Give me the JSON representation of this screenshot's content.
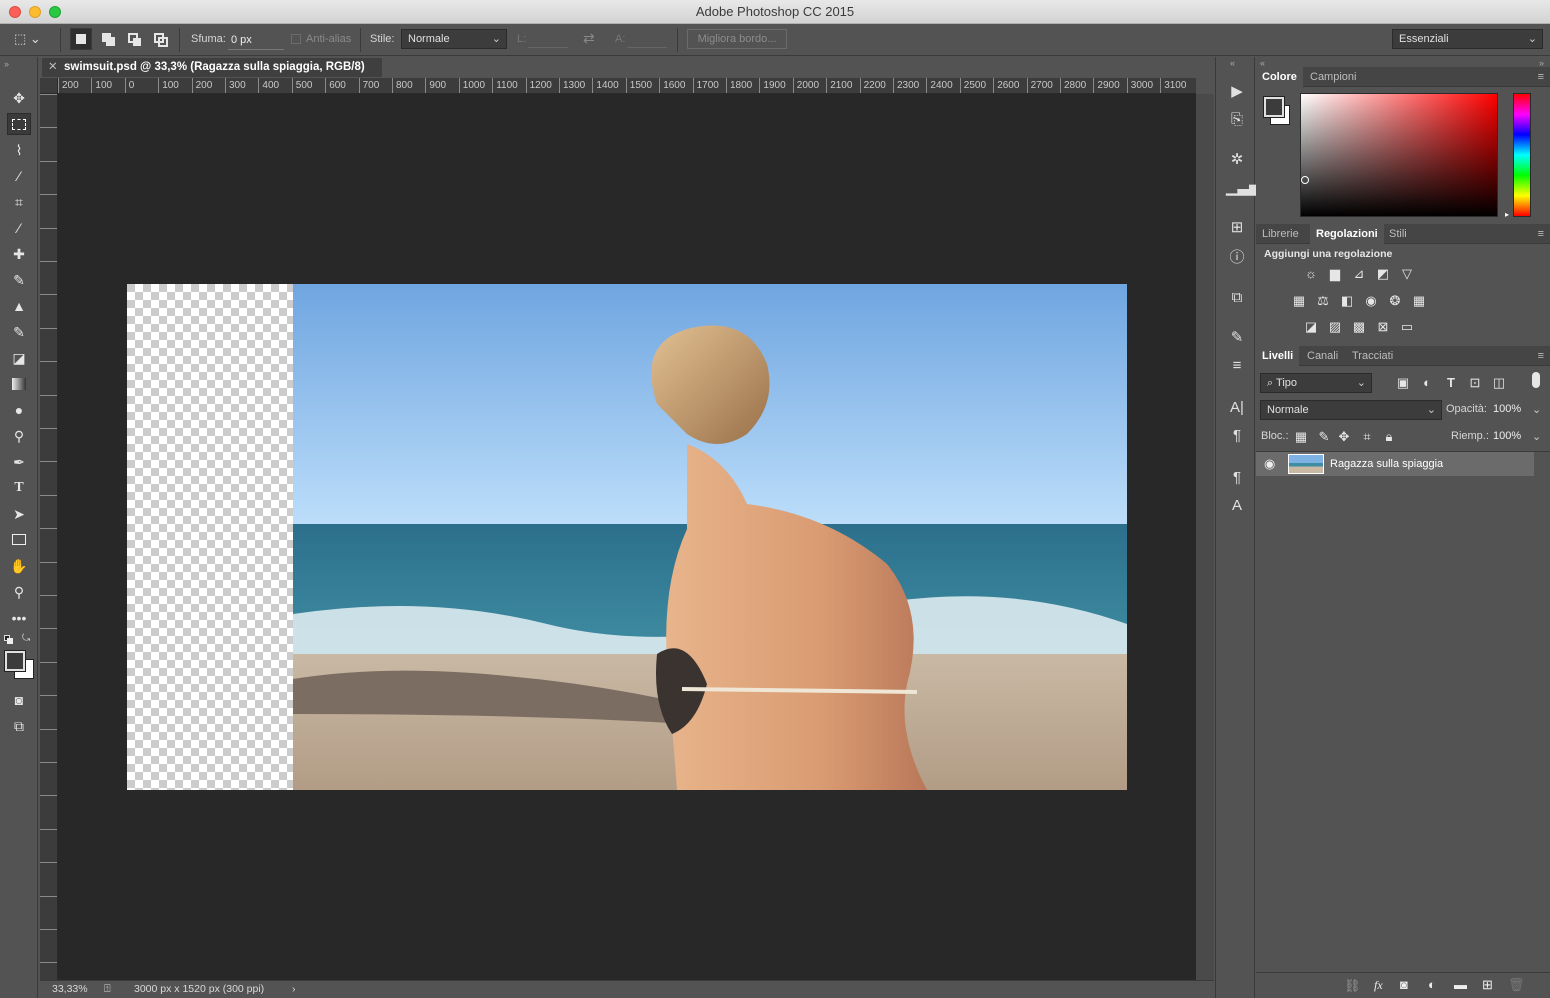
{
  "window": {
    "title": "Adobe Photoshop CC 2015"
  },
  "options": {
    "feather_label": "Sfuma:",
    "feather_value": "0 px",
    "antialias_label": "Anti-alias",
    "style_label": "Stile:",
    "style_value": "Normale",
    "width_label": "L:",
    "height_label": "A:",
    "refine_edge": "Migliora bordo...",
    "workspace": "Essenziali"
  },
  "document": {
    "tab_title": "swimsuit.psd @ 33,3% (Ragazza sulla spiaggia, RGB/8)",
    "ruler_h": [
      "200",
      "100",
      "0",
      "100",
      "200",
      "300",
      "400",
      "500",
      "600",
      "700",
      "800",
      "900",
      "1000",
      "1100",
      "1200",
      "1300",
      "1400",
      "1500",
      "1600",
      "1700",
      "1800",
      "1900",
      "2000",
      "2100",
      "2200",
      "2300",
      "2400",
      "2500",
      "2600",
      "2700",
      "2800",
      "2900",
      "3000",
      "3100"
    ],
    "zoom": "33,33%",
    "size_info": "3000 px x 1520 px (300 ppi)"
  },
  "color_panel": {
    "tabs": [
      "Colore",
      "Campioni"
    ],
    "active": "Colore"
  },
  "adjust_panel": {
    "tabs": [
      "Librerie",
      "Regolazioni",
      "Stili"
    ],
    "active": "Regolazioni",
    "heading": "Aggiungi una regolazione"
  },
  "layers_panel": {
    "tabs": [
      "Livelli",
      "Canali",
      "Tracciati"
    ],
    "active": "Livelli",
    "filter_kind": "Tipo",
    "blend_mode": "Normale",
    "opacity_label": "Opacità:",
    "opacity_value": "100%",
    "lock_label": "Bloc.:",
    "fill_label": "Riemp.:",
    "fill_value": "100%",
    "layers": [
      {
        "name": "Ragazza sulla spiaggia",
        "visible": true
      }
    ]
  },
  "colors": {
    "fg": "#3c3c3c",
    "bg": "#ffffff",
    "canvas": "#282828",
    "sky": "#7fb2e4"
  }
}
